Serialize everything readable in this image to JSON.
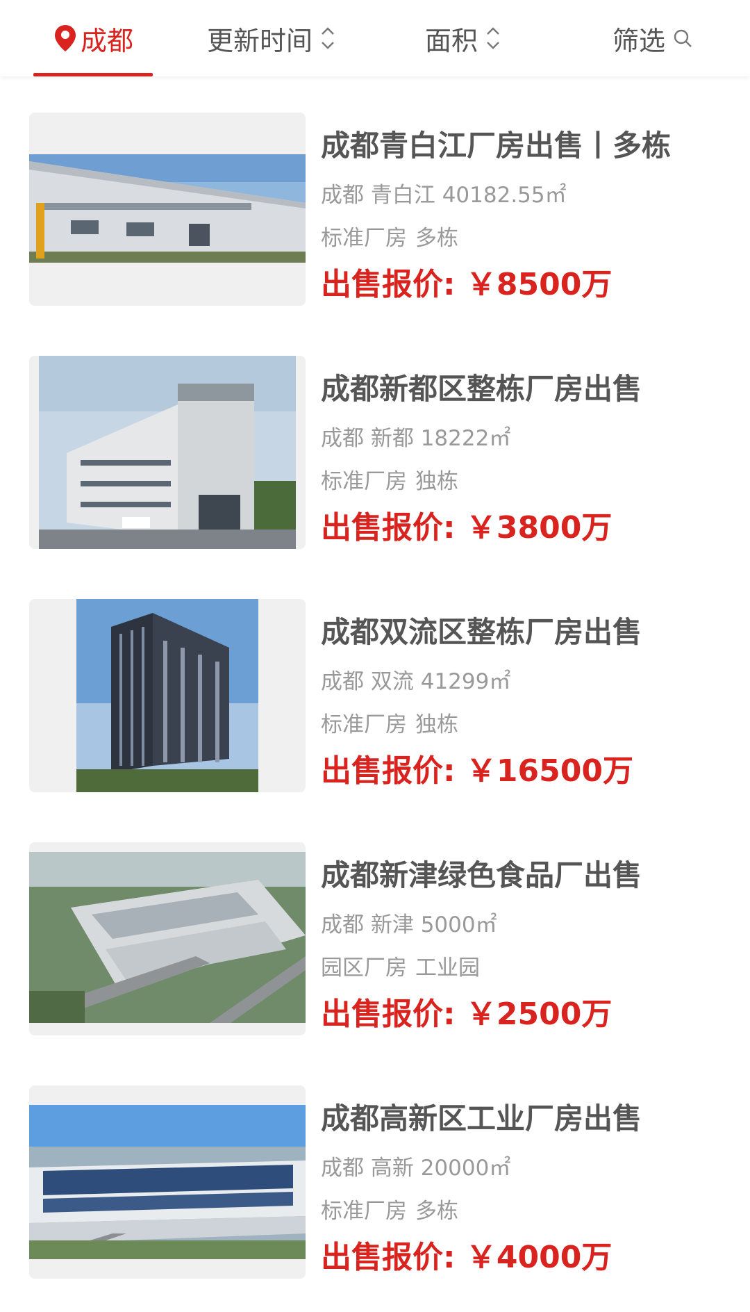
{
  "filter_bar": {
    "city": "成都",
    "sort_update": "更新时间",
    "sort_area": "面积",
    "filter": "筛选"
  },
  "accent_color": "#d8231f",
  "listings": [
    {
      "title": "成都青白江厂房出售丨多栋",
      "meta": "成都 青白江 40182.55㎡",
      "tags": [
        "标准厂房",
        "多栋"
      ],
      "price_label": "出售报价:",
      "price": "￥8500万",
      "image": "industrial-warehouse-photo"
    },
    {
      "title": "成都新都区整栋厂房出售",
      "meta": "成都 新都 18222㎡",
      "tags": [
        "标准厂房",
        "独栋"
      ],
      "price_label": "出售报价:",
      "price": "￥3800万",
      "image": "office-building-photo"
    },
    {
      "title": "成都双流区整栋厂房出售",
      "meta": "成都 双流 41299㎡",
      "tags": [
        "标准厂房",
        "独栋"
      ],
      "price_label": "出售报价:",
      "price": "￥16500万",
      "image": "high-rise-building-photo"
    },
    {
      "title": "成都新津绿色食品厂出售",
      "meta": "成都 新津 5000㎡",
      "tags": [
        "园区厂房",
        "工业园"
      ],
      "price_label": "出售报价:",
      "price": "￥2500万",
      "image": "industrial-park-aerial-photo"
    },
    {
      "title": "成都高新区工业厂房出售",
      "meta": "成都 高新 20000㎡",
      "tags": [
        "标准厂房",
        "多栋"
      ],
      "price_label": "出售报价:",
      "price": "￥4000万",
      "image": "factory-solar-roof-aerial-photo"
    }
  ]
}
